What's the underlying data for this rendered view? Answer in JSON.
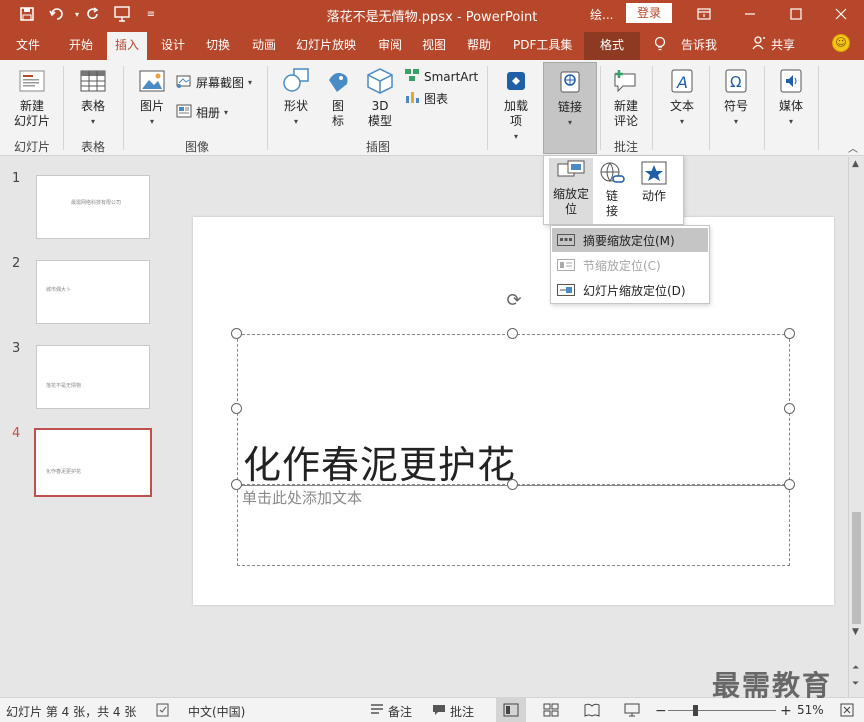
{
  "titlebar": {
    "document_title": "落花不是无情物.ppsx  -  PowerPoint",
    "draw_label": "绘...",
    "login_label": "登录",
    "quick_access": [
      "save-icon",
      "undo-icon",
      "redo-icon",
      "start-from-beginning-icon",
      "customize-qat-icon"
    ],
    "window_controls": [
      "ribbon-display-options-icon",
      "minimize-icon",
      "maximize-icon",
      "close-icon"
    ]
  },
  "tabs": [
    {
      "label": "文件"
    },
    {
      "label": "开始"
    },
    {
      "label": "插入",
      "active": true
    },
    {
      "label": "设计"
    },
    {
      "label": "切换"
    },
    {
      "label": "动画"
    },
    {
      "label": "幻灯片放映"
    },
    {
      "label": "审阅"
    },
    {
      "label": "视图"
    },
    {
      "label": "帮助"
    },
    {
      "label": "PDF工具集"
    },
    {
      "label": "格式",
      "contextual": true
    }
  ],
  "tell_me": "告诉我",
  "share": "共享",
  "ribbon": {
    "slides_group": {
      "new_slide": "新建\n幻灯片",
      "label": "幻灯片"
    },
    "tables_group": {
      "table": "表格",
      "label": "表格"
    },
    "images_group": {
      "pictures": "图片",
      "screenshot": "屏幕截图",
      "album": "相册",
      "label": "图像"
    },
    "illustrations_group": {
      "shapes": "形状",
      "icons": "图\n标",
      "models_3d": "3D\n模型",
      "smartart": "SmartArt",
      "chart": "图表",
      "label": "插图"
    },
    "addins_group": {
      "addins": "加载\n项"
    },
    "links_group": {
      "link": "链接"
    },
    "comments_group": {
      "new_comment": "新建\n评论",
      "label": "批注"
    },
    "text_group": {
      "text": "文本"
    },
    "symbols_group": {
      "symbols": "符号"
    },
    "media_group": {
      "media": "媒体"
    }
  },
  "zoom_gallery": {
    "zoom": "缩放定\n位",
    "link": "链\n接",
    "action": "动作"
  },
  "zoom_menu": [
    {
      "label": "摘要缩放定位(M)",
      "state": "highlighted"
    },
    {
      "label": "节缩放定位(C)",
      "state": "disabled"
    },
    {
      "label": "幻灯片缩放定位(D)",
      "state": "enabled"
    }
  ],
  "thumbnails": [
    {
      "number": "1",
      "text": "最需网络科技有限公司"
    },
    {
      "number": "2",
      "text": "城市偶大卜"
    },
    {
      "number": "3",
      "text": "落花不是无情物"
    },
    {
      "number": "4",
      "text": "化作春泥更护花",
      "selected": true
    }
  ],
  "slide": {
    "title": "化作春泥更护花",
    "body_placeholder": "单击此处添加文本"
  },
  "statusbar": {
    "slide_info": "幻灯片 第 4 张，共 4 张",
    "language": "中文(中国)",
    "notes": "备注",
    "comments": "批注",
    "zoom_percent": "51%",
    "zoom_level": 0.51
  },
  "watermark": "最需教育",
  "colors": {
    "accent": "#b7472a",
    "contextual_tab": "#8e3a22",
    "selected_thumb_border": "#c0504d"
  }
}
